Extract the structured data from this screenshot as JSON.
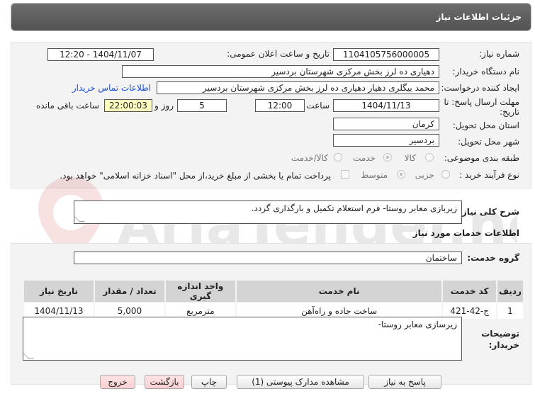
{
  "header": {
    "title": "جزئیات اطلاعات نیاز"
  },
  "fields": {
    "need_number_label": "شماره نیاز:",
    "need_number": "1104105756000005",
    "announce_label": "تاریخ و ساعت اعلان عمومی:",
    "announce_value": "1404/11/07 - 12:20",
    "buyer_label": "نام دستگاه خریدار:",
    "buyer_value": "دهیاری ده لرز بخش مرکزی شهرستان بردسیر",
    "creator_label": "ایجاد کننده درخواست:",
    "creator_value": "محمد بیگلری دهیار دهیاری ده لرز بخش مرکزی شهرستان بردسیر",
    "contact_link": "اطلاعات تماس خریدار",
    "deadline_label_1": "مهلت ارسال پاسخ: تا",
    "deadline_label_2": "تاریخ:",
    "deadline_date": "1404/11/13",
    "time_label": "ساعت",
    "deadline_time": "12:00",
    "days_value": "5",
    "days_label": "روز و",
    "remaining_time": "22:00:03",
    "remaining_label": "ساعت باقی مانده",
    "province_label": "استان محل تحویل:",
    "province_value": "کرمان",
    "city_label": "شهر محل تحویل:",
    "city_value": "بردسیر",
    "category_label": "طبقه بندی موضوعی:",
    "category_options": [
      "کالا",
      "خدمت",
      "کالا/خدمت"
    ],
    "process_label": "نوع فرآیند خرید :",
    "process_options": [
      "جزیی",
      "متوسط"
    ],
    "payment_note": "پرداخت تمام یا بخشی از مبلغ خرید،از محل \"اسناد خزانه اسلامی\" خواهد بود."
  },
  "summary": {
    "label": "شرح کلی نیاز:",
    "value": "زیربازی معابر روستا- فرم استعلام تکمیل و بارگذاری گردد."
  },
  "services": {
    "section_title": "اطلاعات خدمات مورد نیاز",
    "group_label": "گروه خدمت:",
    "group_value": "ساختمان",
    "columns": [
      "ردیف",
      "کد خدمت",
      "نام خدمت",
      "واحد اندازه گیری",
      "تعداد / مقدار",
      "تاریخ نیاز"
    ],
    "rows": [
      [
        "1",
        "ج-42-421",
        "ساخت جاده و راه‌آهن",
        "مترمربع",
        "5,000",
        "1404/11/13"
      ]
    ]
  },
  "buyer_notes": {
    "label_1": "توضیحات",
    "label_2": "خریدار:",
    "value": "زیرسازی معابر روستا-"
  },
  "buttons": {
    "reply": "پاسخ به نیاز",
    "docs": "مشاهده مدارک پیوستی (1)",
    "print": "چاپ",
    "back": "بازگشت",
    "exit": "خروج"
  },
  "watermark": {
    "text": "AriaTender.neT"
  },
  "colors": {
    "title_bar": "#5f5f5f",
    "link": "#1a4fd6",
    "remaining_bg": "#ffffc0"
  }
}
